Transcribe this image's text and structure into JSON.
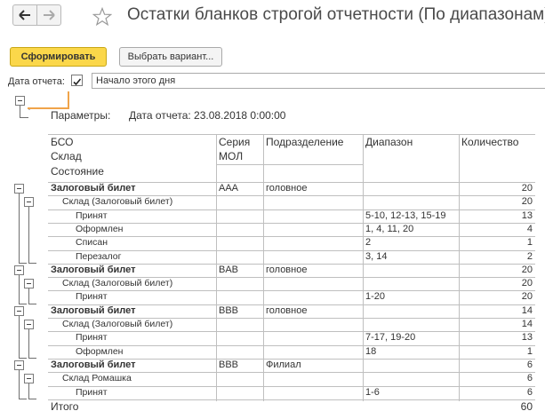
{
  "window": {
    "title": "Остатки бланков строгой отчетности (По диапазонам)"
  },
  "toolbar": {
    "generate_label": "Сформировать",
    "variant_label": "Выбрать вариант..."
  },
  "filter": {
    "date_label": "Дата отчета:",
    "date_checked": true,
    "date_value": "Начало этого дня"
  },
  "report": {
    "params_label": "Параметры:",
    "params_value": "Дата отчета: 23.08.2018 0:00:00",
    "headers": {
      "bso": "БСО",
      "sklad": "Склад",
      "state": "Состояние",
      "series": "Серия",
      "series_sub": "МОЛ",
      "division": "Подразделение",
      "range": "Диапазон",
      "qty": "Количество"
    },
    "rows": [
      {
        "level": 0,
        "name": "Залоговый билет",
        "series": "AAA",
        "division": "головное",
        "range": "",
        "qty": "20"
      },
      {
        "level": 1,
        "name": "Склад (Залоговый билет)",
        "series": "",
        "division": "",
        "range": "",
        "qty": "20"
      },
      {
        "level": 2,
        "name": "Принят",
        "series": "",
        "division": "",
        "range": "5-10, 12-13, 15-19",
        "qty": "13"
      },
      {
        "level": 2,
        "name": "Оформлен",
        "series": "",
        "division": "",
        "range": "1, 4, 11, 20",
        "qty": "4"
      },
      {
        "level": 2,
        "name": "Списан",
        "series": "",
        "division": "",
        "range": "2",
        "qty": "1"
      },
      {
        "level": 2,
        "name": "Перезалог",
        "series": "",
        "division": "",
        "range": "3, 14",
        "qty": "2"
      },
      {
        "level": 0,
        "name": "Залоговый билет",
        "series": "BAB",
        "division": "головное",
        "range": "",
        "qty": "20"
      },
      {
        "level": 1,
        "name": "Склад (Залоговый билет)",
        "series": "",
        "division": "",
        "range": "",
        "qty": "20"
      },
      {
        "level": 2,
        "name": "Принят",
        "series": "",
        "division": "",
        "range": "1-20",
        "qty": "20"
      },
      {
        "level": 0,
        "name": "Залоговый билет",
        "series": "BBB",
        "division": "головное",
        "range": "",
        "qty": "14"
      },
      {
        "level": 1,
        "name": "Склад (Залоговый билет)",
        "series": "",
        "division": "",
        "range": "",
        "qty": "14"
      },
      {
        "level": 2,
        "name": "Принят",
        "series": "",
        "division": "",
        "range": "7-17, 19-20",
        "qty": "13"
      },
      {
        "level": 2,
        "name": "Оформлен",
        "series": "",
        "division": "",
        "range": "18",
        "qty": "1"
      },
      {
        "level": 0,
        "name": "Залоговый билет",
        "series": "BBB",
        "division": "Филиал",
        "range": "",
        "qty": "6"
      },
      {
        "level": 1,
        "name": "Склад Ромашка",
        "series": "",
        "division": "",
        "range": "",
        "qty": "6"
      },
      {
        "level": 2,
        "name": "Принят",
        "series": "",
        "division": "",
        "range": "1-6",
        "qty": "6"
      }
    ],
    "total_label": "Итого",
    "total_qty": "60"
  }
}
